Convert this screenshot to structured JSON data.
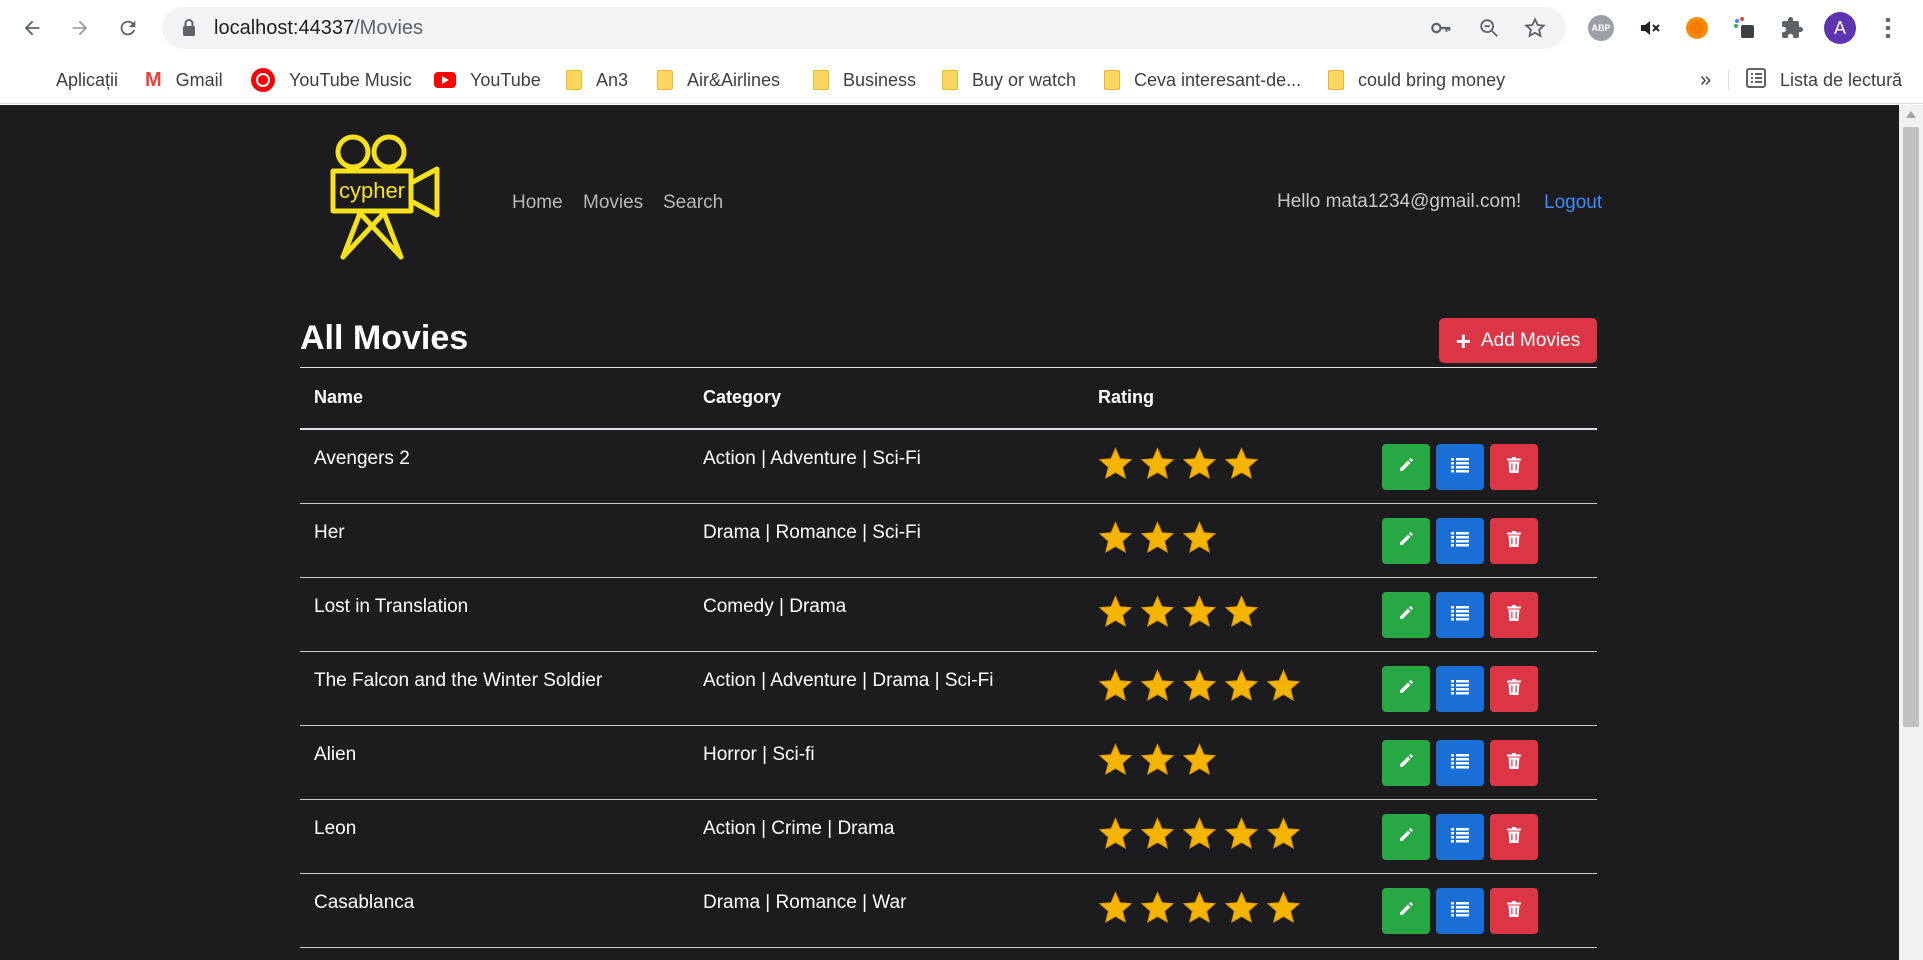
{
  "browser": {
    "url_host": "localhost:44337",
    "url_path": "/Movies",
    "bookmarks": [
      {
        "label": "Aplicații",
        "icon": "apps-grid-icon"
      },
      {
        "label": "Gmail",
        "icon": "gmail-icon"
      },
      {
        "label": "YouTube Music",
        "icon": "youtube-music-icon"
      },
      {
        "label": "YouTube",
        "icon": "youtube-icon"
      },
      {
        "label": "An3",
        "icon": "folder-icon"
      },
      {
        "label": "Air&Airlines",
        "icon": "folder-icon"
      },
      {
        "label": "Business",
        "icon": "folder-icon"
      },
      {
        "label": "Buy or watch",
        "icon": "folder-icon"
      },
      {
        "label": "Ceva interesant-de...",
        "icon": "folder-icon"
      },
      {
        "label": "could bring money",
        "icon": "folder-icon"
      }
    ],
    "more_bookmarks": "»",
    "reading_list": "Lista de lectură",
    "abp_label": "ABP",
    "avatar_letter": "A"
  },
  "site": {
    "logo_text": "cypher",
    "nav": [
      "Home",
      "Movies",
      "Search"
    ],
    "greeting": "Hello mata1234@gmail.com!",
    "logout": "Logout"
  },
  "page": {
    "title": "All Movies",
    "add_button": "Add Movies"
  },
  "table": {
    "headers": {
      "name": "Name",
      "category": "Category",
      "rating": "Rating"
    },
    "rows": [
      {
        "name": "Avengers 2",
        "category": "Action | Adventure | Sci-Fi",
        "rating": 4
      },
      {
        "name": "Her",
        "category": "Drama | Romance | Sci-Fi",
        "rating": 3
      },
      {
        "name": "Lost in Translation",
        "category": "Comedy | Drama",
        "rating": 4
      },
      {
        "name": "The Falcon and the Winter Soldier",
        "category": "Action | Adventure | Drama | Sci-Fi",
        "rating": 5
      },
      {
        "name": "Alien",
        "category": "Horror | Sci-fi",
        "rating": 3
      },
      {
        "name": "Leon",
        "category": "Action | Crime | Drama",
        "rating": 5
      },
      {
        "name": "Casablanca",
        "category": "Drama | Romance | War",
        "rating": 5
      }
    ]
  },
  "colors": {
    "page_bg": "#1c1c1e",
    "logo": "#f7e11d",
    "star": "#f5b400",
    "edit": "#28a745",
    "details": "#1a6fd6",
    "delete": "#dc3545",
    "link": "#3d8bfd"
  }
}
